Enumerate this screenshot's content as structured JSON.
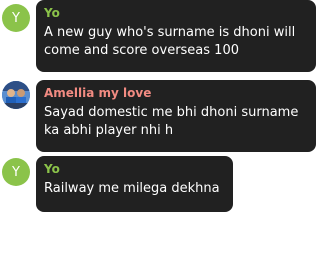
{
  "messages": [
    {
      "sender": "Yo",
      "sender_color": "#8bc34a",
      "avatar_letter": "Y",
      "avatar_kind": "letter",
      "text": "A new guy who's surname is dhoni will\ncome and score overseas 100"
    },
    {
      "sender": "Amellia my love",
      "sender_color": "#f28b82",
      "avatar_kind": "photo",
      "text": "Sayad domestic me bhi dhoni surname\nka abhi player nhi h"
    },
    {
      "sender": "Yo",
      "sender_color": "#8bc34a",
      "avatar_letter": "Y",
      "avatar_kind": "letter",
      "text": "Railway me milega dekhna"
    }
  ]
}
